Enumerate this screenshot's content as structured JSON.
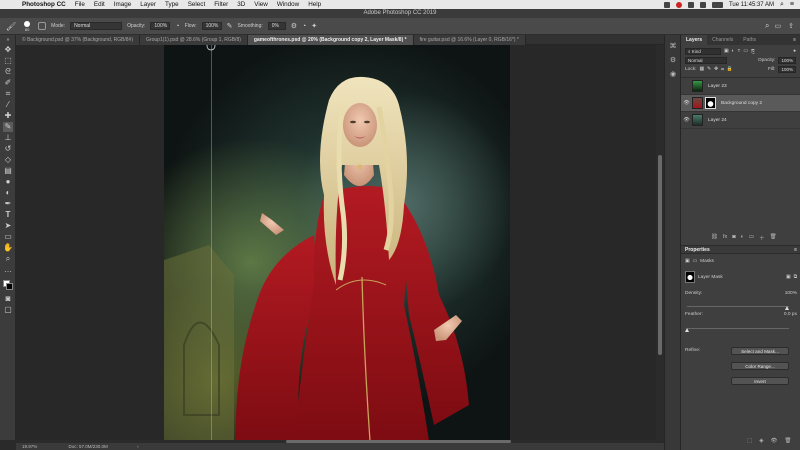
{
  "menubar": {
    "app_name": "Photoshop CC",
    "items": [
      "File",
      "Edit",
      "Image",
      "Layer",
      "Type",
      "Select",
      "Filter",
      "3D",
      "View",
      "Window",
      "Help"
    ],
    "clock": "Tue 11:45:37 AM"
  },
  "window_title": "Adobe Photoshop CC 2019",
  "options": {
    "brush_size": "80",
    "mode_label": "Mode:",
    "mode_value": "Normal",
    "opacity_label": "Opacity:",
    "opacity_value": "100%",
    "flow_label": "Flow:",
    "flow_value": "100%",
    "smoothing_label": "Smoothing:",
    "smoothing_value": "0%"
  },
  "tabs": [
    "© Background.psd @ 37% (Background, RGB/8#)",
    "Group1(1).psd @ 28.6% (Group 1, RGB/8)",
    "gameofthrones.psd @ 20% (Background copy 2, Layer Mask/8) *",
    "fire guitar.psd @ 16.6% (Layer 0, RGB/16*) *"
  ],
  "status": {
    "zoom": "19.97%",
    "doc": "Doc: 57.0M/230.0M"
  },
  "layers_panel": {
    "tabs": [
      "Layers",
      "Channels",
      "Paths"
    ],
    "kind_label": "Kind",
    "blend_mode": "Normal",
    "opacity_label": "Opacity:",
    "opacity_value": "100%",
    "lock_label": "Lock:",
    "fill_label": "Fill:",
    "fill_value": "100%",
    "layers": [
      {
        "name": "Layer 23",
        "visible": false,
        "selected": false
      },
      {
        "name": "Background copy 2",
        "visible": true,
        "selected": true
      },
      {
        "name": "Layer 24",
        "visible": true,
        "selected": false
      }
    ]
  },
  "properties_panel": {
    "title": "Properties",
    "subtitle": "Masks",
    "mask_label": "Layer Mask",
    "density_label": "Density:",
    "density_value": "100%",
    "density_level": 1.0,
    "feather_label": "Feather:",
    "feather_value": "0.0 px",
    "feather_level": 0.0,
    "refine_label": "Refine:",
    "select_mask_label": "Select and Mask...",
    "color_range_label": "Color Range...",
    "invert_label": "Invert"
  },
  "colors": {
    "dress_red": "#a3141b",
    "hair_blond": "#e7d9a8",
    "smoke_teal": "#6f9a92",
    "ui_dark": "#3f3f3f"
  }
}
